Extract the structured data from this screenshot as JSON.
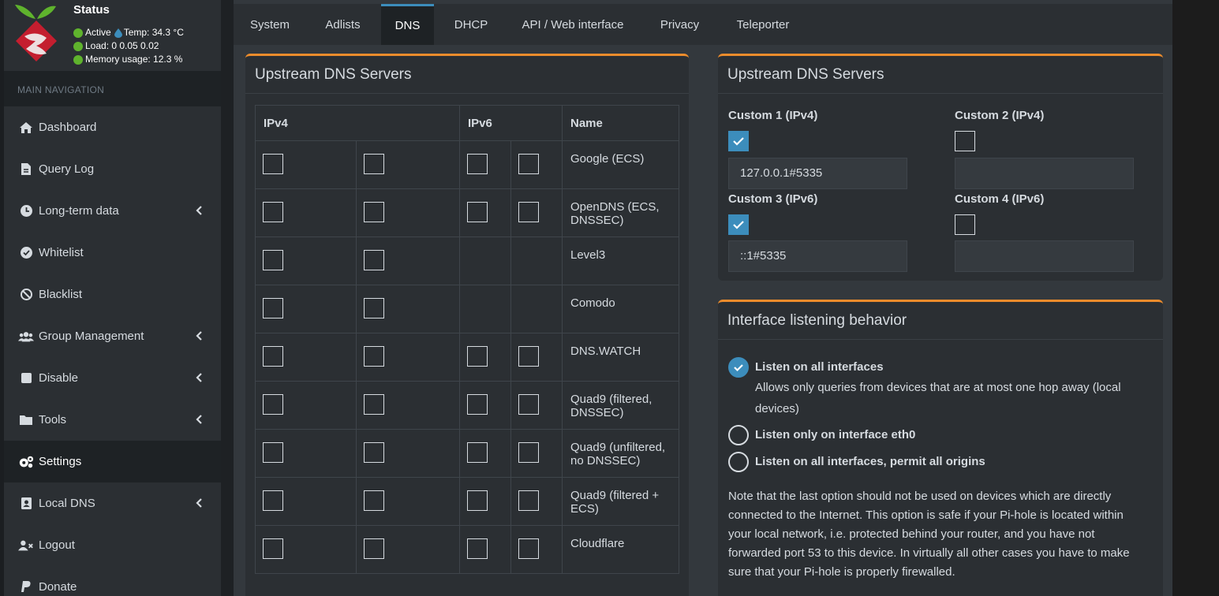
{
  "status": {
    "title": "Status",
    "active": "Active",
    "temp": "Temp: 34.3 °C",
    "load": "Load:  0  0.05  0.02",
    "memory": "Memory usage:  12.3 %"
  },
  "nav_header": "MAIN NAVIGATION",
  "nav": [
    {
      "label": "Dashboard",
      "icon": "home-icon",
      "chevron": false,
      "active": false
    },
    {
      "label": "Query Log",
      "icon": "file-icon",
      "chevron": false,
      "active": false
    },
    {
      "label": "Long-term data",
      "icon": "clock-icon",
      "chevron": true,
      "active": false
    },
    {
      "label": "Whitelist",
      "icon": "check-circle-icon",
      "chevron": false,
      "active": false
    },
    {
      "label": "Blacklist",
      "icon": "ban-icon",
      "chevron": false,
      "active": false
    },
    {
      "label": "Group Management",
      "icon": "users-icon",
      "chevron": true,
      "active": false
    },
    {
      "label": "Disable",
      "icon": "stop-icon",
      "chevron": true,
      "active": false
    },
    {
      "label": "Tools",
      "icon": "folder-icon",
      "chevron": true,
      "active": false
    },
    {
      "label": "Settings",
      "icon": "gears-icon",
      "chevron": false,
      "active": true
    },
    {
      "label": "Local DNS",
      "icon": "address-card-icon",
      "chevron": true,
      "active": false
    },
    {
      "label": "Logout",
      "icon": "user-x-icon",
      "chevron": false,
      "active": false
    },
    {
      "label": "Donate",
      "icon": "paypal-icon",
      "chevron": false,
      "active": false
    }
  ],
  "tabs": [
    "System",
    "Adlists",
    "DNS",
    "DHCP",
    "API / Web interface",
    "Privacy",
    "Teleporter"
  ],
  "active_tab": "DNS",
  "upstream_left": {
    "title": "Upstream DNS Servers",
    "headers": {
      "ipv4": "IPv4",
      "ipv6": "IPv6",
      "name": "Name"
    },
    "rows": [
      {
        "name": "Google (ECS)",
        "has_ipv6": true
      },
      {
        "name": "OpenDNS (ECS, DNSSEC)",
        "has_ipv6": true
      },
      {
        "name": "Level3",
        "has_ipv6": false
      },
      {
        "name": "Comodo",
        "has_ipv6": false
      },
      {
        "name": "DNS.WATCH",
        "has_ipv6": true
      },
      {
        "name": "Quad9 (filtered, DNSSEC)",
        "has_ipv6": true
      },
      {
        "name": "Quad9 (unfiltered, no DNSSEC)",
        "has_ipv6": true
      },
      {
        "name": "Quad9 (filtered + ECS)",
        "has_ipv6": true
      },
      {
        "name": "Cloudflare",
        "has_ipv6": true
      }
    ]
  },
  "upstream_right": {
    "title": "Upstream DNS Servers",
    "custom1": {
      "label": "Custom 1 (IPv4)",
      "checked": true,
      "value": "127.0.0.1#5335"
    },
    "custom2": {
      "label": "Custom 2 (IPv4)",
      "checked": false,
      "value": ""
    },
    "custom3": {
      "label": "Custom 3 (IPv6)",
      "checked": true,
      "value": "::1#5335"
    },
    "custom4": {
      "label": "Custom 4 (IPv6)",
      "checked": false,
      "value": ""
    }
  },
  "interface": {
    "title": "Interface listening behavior",
    "option1": "Listen on all interfaces",
    "option1_desc_line1": "Allows only queries from devices that are at most one hop away (local",
    "option1_desc_line2": "devices)",
    "option2": "Listen only on interface eth0",
    "option3": "Listen on all interfaces, permit all origins",
    "note_lines": [
      "Note that the last option should not be used on devices which are directly",
      "connected to the Internet. This option is safe if your Pi-hole is located within",
      "your local network, i.e. protected behind your router, and you have not",
      "forwarded port 53 to this device. In virtually all other cases you have to make",
      "sure that your Pi-hole is properly firewalled."
    ]
  },
  "colors": {
    "accent_orange": "#ed8c2c",
    "accent_blue": "#3c8dbc",
    "status_green": "#5fb32d"
  }
}
